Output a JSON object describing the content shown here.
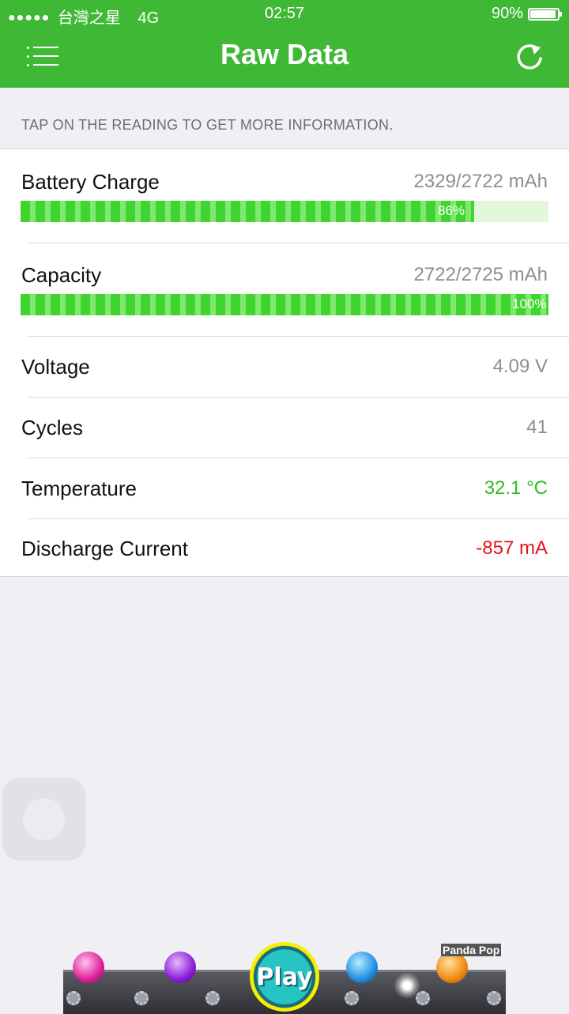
{
  "status_bar": {
    "signal_dots": "●●●●●",
    "carrier": "台灣之星",
    "network": "4G",
    "time": "02:57",
    "battery_percent": "90%"
  },
  "header": {
    "title": "Raw Data",
    "menu_icon": "list-icon",
    "refresh_icon": "refresh-icon",
    "background_color": "#3fb835"
  },
  "hint": "TAP ON THE READING TO GET MORE INFORMATION.",
  "readings": {
    "battery_charge": {
      "label": "Battery Charge",
      "value": "2329/2722 mAh",
      "percent_label": "86%",
      "fill_fraction": 0.86
    },
    "capacity": {
      "label": "Capacity",
      "value": "2722/2725 mAh",
      "percent_label": "100%",
      "fill_fraction": 1.0
    },
    "voltage": {
      "label": "Voltage",
      "value": "4.09 V"
    },
    "cycles": {
      "label": "Cycles",
      "value": "41"
    },
    "temperature": {
      "label": "Temperature",
      "value": "32.1 °C",
      "color": "#2ebd1f"
    },
    "discharge_current": {
      "label": "Discharge Current",
      "value": "-857 mA",
      "color": "#e3141b"
    }
  },
  "ad": {
    "play_label": "Play",
    "game_name": "Panda Pop"
  }
}
